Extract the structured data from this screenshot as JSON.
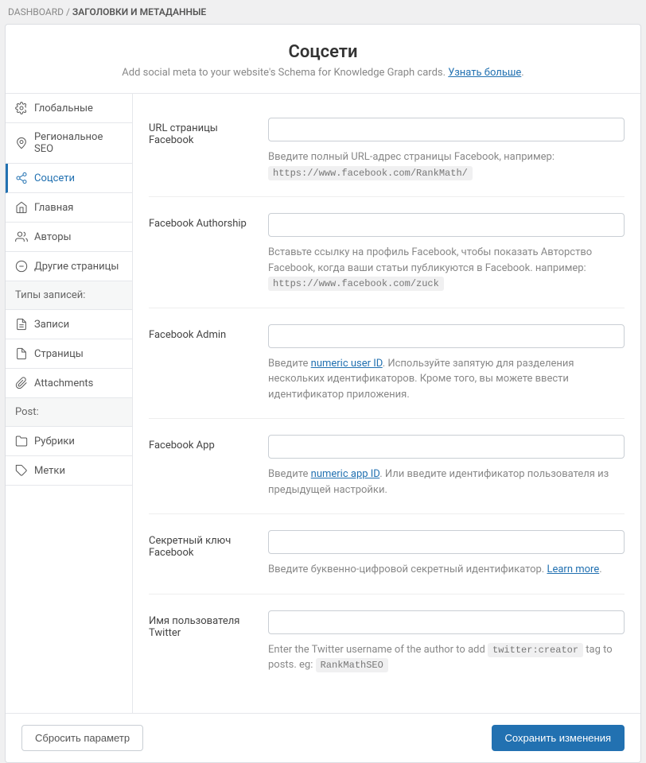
{
  "breadcrumb": {
    "root": "DASHBOARD",
    "sep": "/",
    "current": "ЗАГОЛОВКИ И МЕТАДАННЫЕ"
  },
  "header": {
    "title": "Соцсети",
    "subtitle_prefix": "Add social meta to your website's Schema for Knowledge Graph cards. ",
    "subtitle_link": "Узнать больше",
    "subtitle_suffix": "."
  },
  "sidebar": {
    "items_top": [
      {
        "label": "Глобальные",
        "icon": "settings"
      },
      {
        "label": "Региональное SEO",
        "icon": "pin"
      },
      {
        "label": "Соцсети",
        "icon": "share",
        "active": true
      },
      {
        "label": "Главная",
        "icon": "home"
      },
      {
        "label": "Авторы",
        "icon": "users"
      },
      {
        "label": "Другие страницы",
        "icon": "minus-circle"
      }
    ],
    "section1": "Типы записей:",
    "items_mid": [
      {
        "label": "Записи",
        "icon": "doc"
      },
      {
        "label": "Страницы",
        "icon": "page"
      },
      {
        "label": "Attachments",
        "icon": "clip"
      }
    ],
    "section2": "Post:",
    "items_bot": [
      {
        "label": "Рубрики",
        "icon": "folder"
      },
      {
        "label": "Метки",
        "icon": "tag"
      }
    ]
  },
  "fields": {
    "fb_url": {
      "label": "URL страницы Facebook",
      "desc_text": "Введите полный URL-адрес страницы Facebook, например: ",
      "desc_code": "https://www.facebook.com/RankMath/"
    },
    "fb_author": {
      "label": "Facebook Authorship",
      "desc_text": "Вставьте ссылку на профиль Facebook, чтобы показать Авторство Facebook, когда ваши статьи публикуются в Facebook. например: ",
      "desc_code": "https://www.facebook.com/zuck"
    },
    "fb_admin": {
      "label": "Facebook Admin",
      "desc_pre": "Введите ",
      "desc_link": "numeric user ID",
      "desc_post": ". Используйте запятую для разделения нескольких идентификаторов. Кроме того, вы можете ввести идентификатор приложения."
    },
    "fb_app": {
      "label": "Facebook App",
      "desc_pre": "Введите ",
      "desc_link": "numeric app ID",
      "desc_post": ". Или введите идентификатор пользователя из предыдущей настройки."
    },
    "fb_secret": {
      "label": "Секретный ключ Facebook",
      "desc_pre": "Введите буквенно-цифровой секретный идентификатор. ",
      "desc_link": "Learn more",
      "desc_post": "."
    },
    "tw_user": {
      "label": "Имя пользователя Twitter",
      "desc_pre": "Enter the Twitter username of the author to add ",
      "desc_code": "twitter:creator",
      "desc_mid": " tag to posts. eg: ",
      "desc_code2": "RankMathSEO"
    }
  },
  "footer": {
    "reset": "Сбросить параметр",
    "save": "Сохранить изменения"
  }
}
